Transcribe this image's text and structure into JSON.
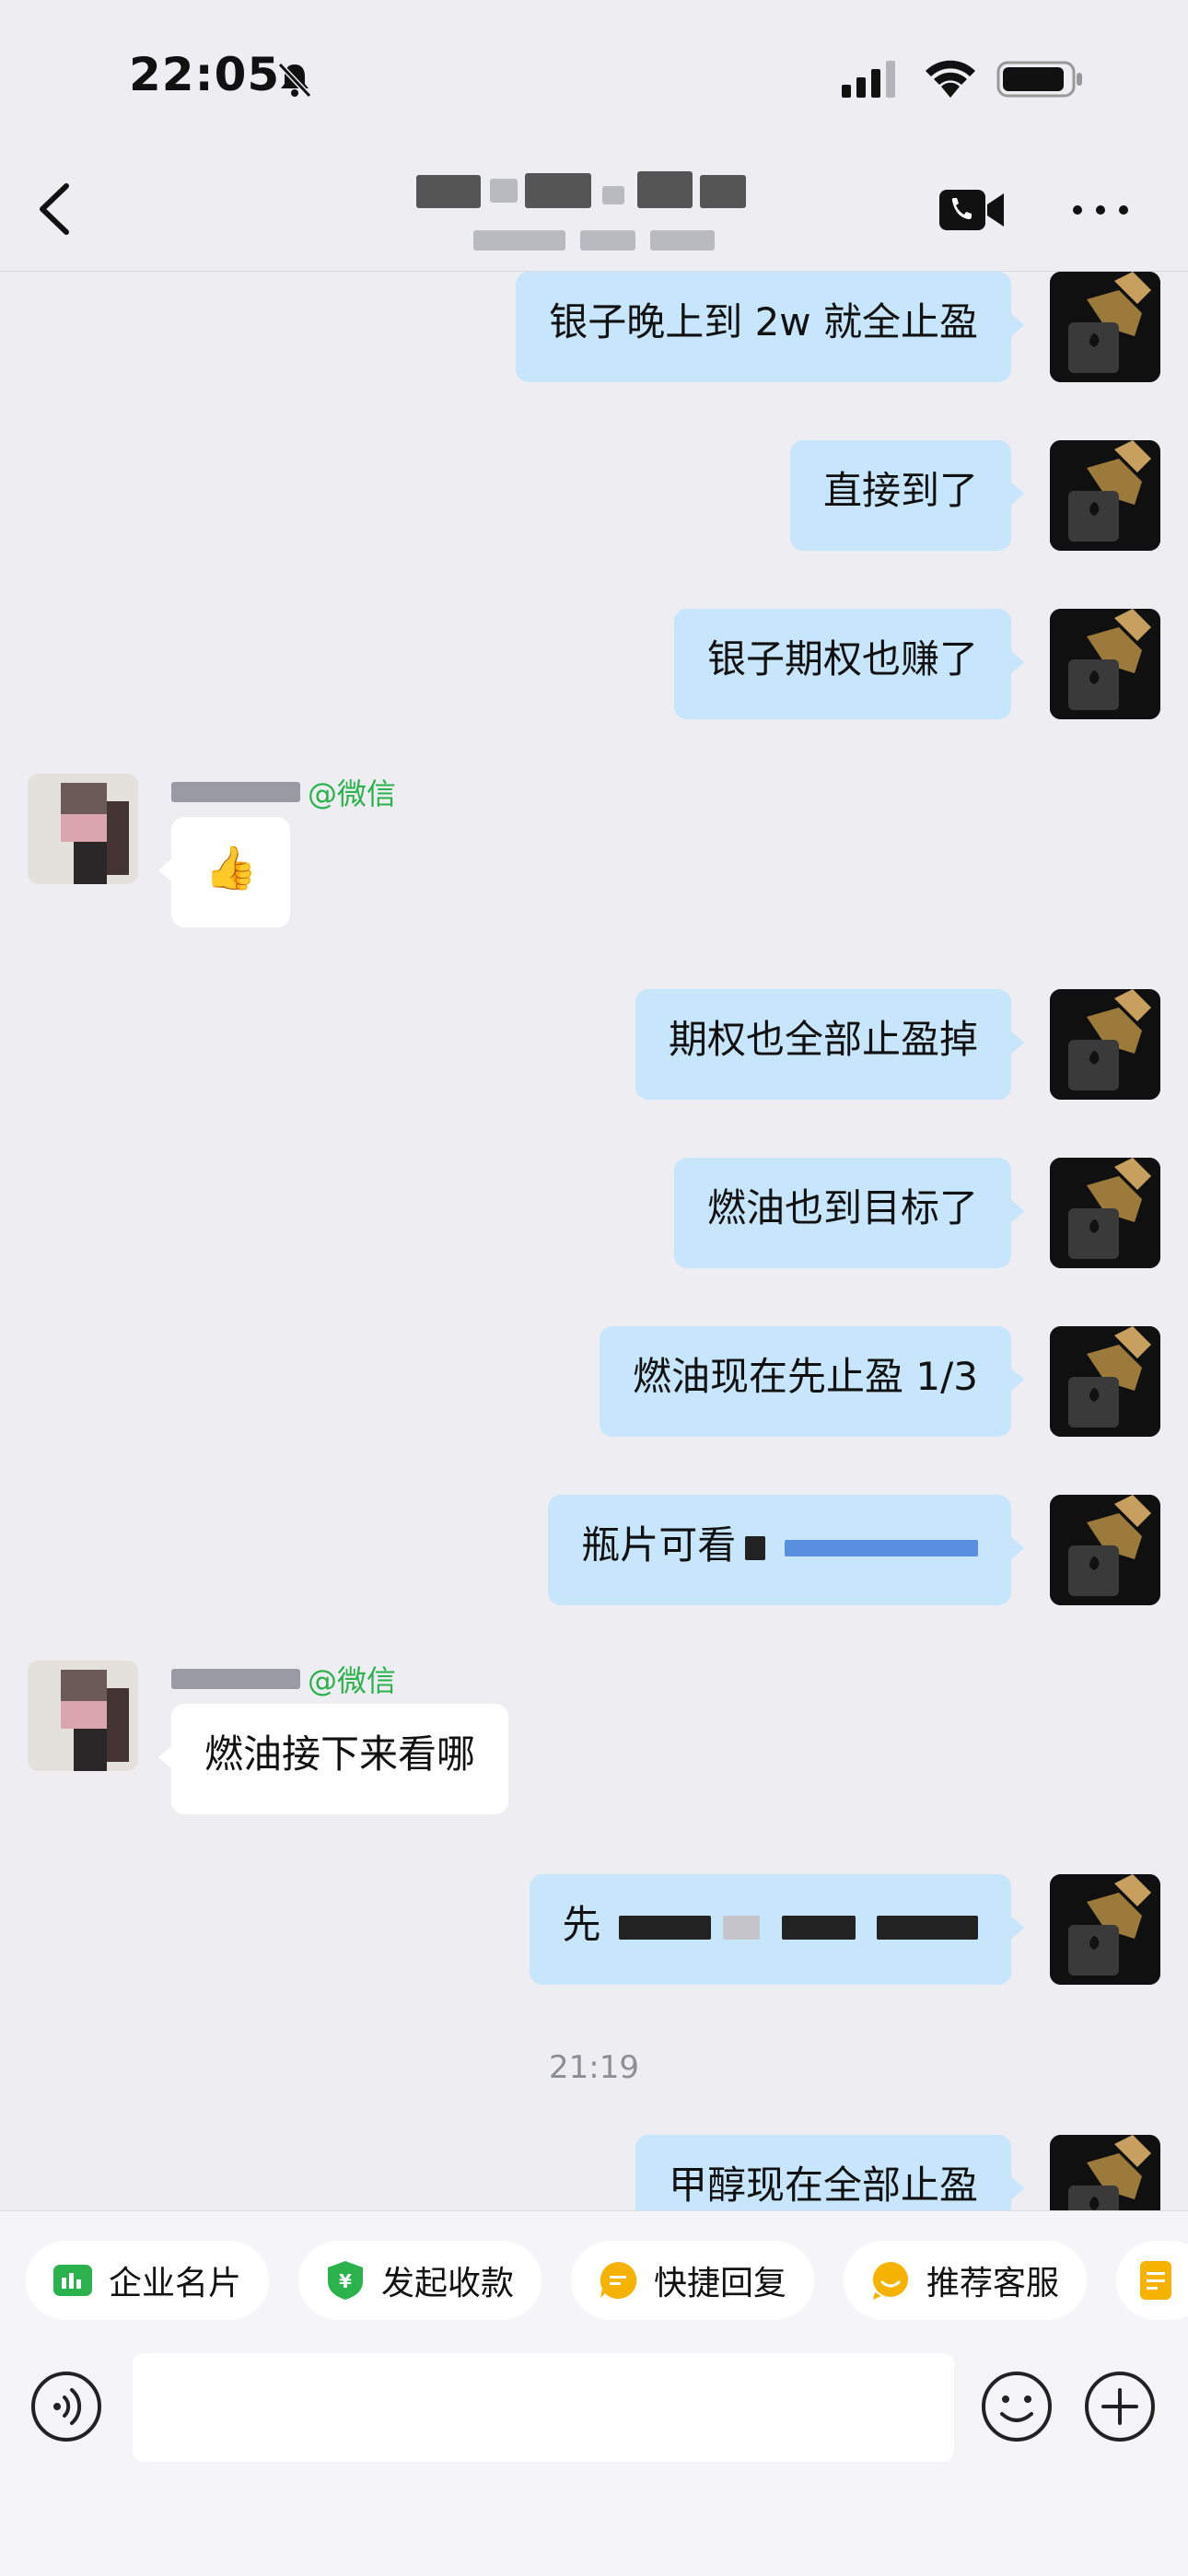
{
  "status_bar": {
    "time": "22:05"
  },
  "nav": {
    "title": "",
    "subtitle": ""
  },
  "messages": [
    {
      "side": "self",
      "text": "银子晚上到 2w 就全止盈"
    },
    {
      "side": "self",
      "text": "直接到了"
    },
    {
      "side": "self",
      "text": "银子期权也赚了"
    },
    {
      "side": "other",
      "source": "@微信",
      "text": "👍"
    },
    {
      "side": "self",
      "text": "期权也全部止盈掉"
    },
    {
      "side": "self",
      "text": "燃油也到目标了"
    },
    {
      "side": "self",
      "text": "燃油现在先止盈 1/3"
    },
    {
      "side": "self",
      "text": "瓶片可看"
    },
    {
      "side": "other",
      "source": "@微信",
      "text": "燃油接下来看哪"
    },
    {
      "side": "self",
      "text": "先"
    },
    {
      "side": "time",
      "text": "21:19"
    },
    {
      "side": "self",
      "text": "甲醇现在全部止盈"
    }
  ],
  "quick_actions": [
    {
      "label": "企业名片",
      "icon": "business-card-icon",
      "color": "#2bb24c"
    },
    {
      "label": "发起收款",
      "icon": "collect-payment-icon",
      "color": "#2bb24c"
    },
    {
      "label": "快捷回复",
      "icon": "quick-reply-icon",
      "color": "#f5b300"
    },
    {
      "label": "推荐客服",
      "icon": "recommend-service-icon",
      "color": "#f5b300"
    },
    {
      "label": "",
      "icon": "document-icon",
      "color": "#f5b300"
    }
  ],
  "input": {
    "placeholder": ""
  },
  "colors": {
    "self_bubble": "#c7e5fb",
    "other_bubble": "#ffffff",
    "background": "#ededf2",
    "wechat_green": "#2bb24c"
  }
}
